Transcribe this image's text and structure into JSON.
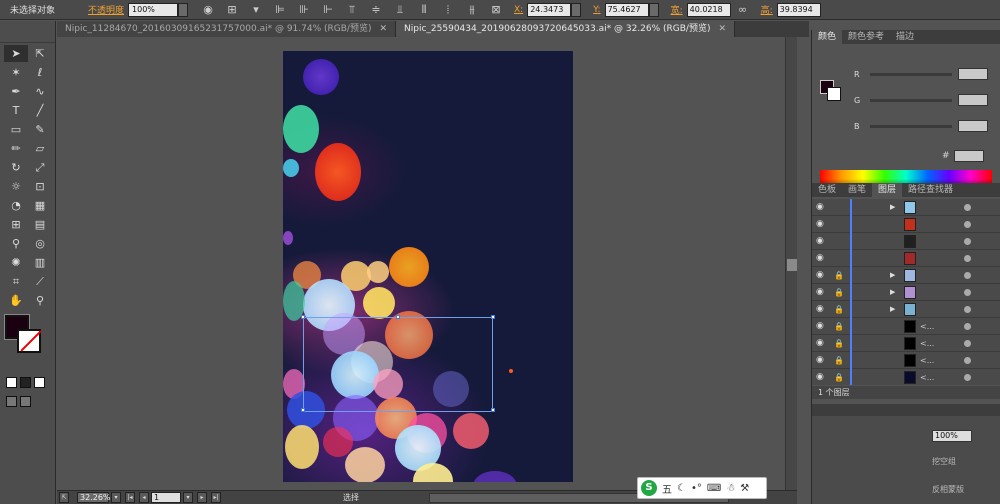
{
  "control_bar": {
    "selection_status": "未选择对象",
    "opacity_label": "不透明度",
    "opacity_value": "100%",
    "x_label": "X:",
    "x_value": "24.3473",
    "y_label": "Y:",
    "y_value": "75.4627",
    "w_label": "宽:",
    "w_value": "40.0218",
    "h_label": "高:",
    "h_value": "39.8394"
  },
  "tabs": [
    {
      "label": "Nipic_11284670_20160309165231757000.ai* @ 91.74% (RGB/预览)",
      "active": false
    },
    {
      "label": "Nipic_25590434_20190628093720645033.ai* @ 32.26% (RGB/预览)",
      "active": true
    }
  ],
  "status_bar": {
    "zoom": "32.26%",
    "page": "1",
    "mode": "选择"
  },
  "color_panel": {
    "tabs": [
      "颜色",
      "颜色参考",
      "描边"
    ],
    "r_label": "R",
    "g_label": "G",
    "b_label": "B",
    "hex_label": "#"
  },
  "layers_panel": {
    "tabs": [
      "色板",
      "画笔",
      "图层",
      "路径查找器"
    ],
    "rows": [
      {
        "locked": false,
        "expandable": true,
        "thumb": "#8fc8e8",
        "name": ""
      },
      {
        "locked": false,
        "expandable": false,
        "thumb": "#c0301a",
        "name": ""
      },
      {
        "locked": false,
        "expandable": false,
        "thumb": "#202020",
        "name": ""
      },
      {
        "locked": false,
        "expandable": false,
        "thumb": "#a02a2a",
        "name": ""
      },
      {
        "locked": true,
        "expandable": true,
        "thumb": "#9fb8e0",
        "name": ""
      },
      {
        "locked": true,
        "expandable": true,
        "thumb": "#b090d0",
        "name": ""
      },
      {
        "locked": true,
        "expandable": true,
        "thumb": "#7ab0d0",
        "name": ""
      },
      {
        "locked": true,
        "expandable": false,
        "thumb": "#000000",
        "name": "<..."
      },
      {
        "locked": true,
        "expandable": false,
        "thumb": "#000000",
        "name": "<..."
      },
      {
        "locked": true,
        "expandable": false,
        "thumb": "#000000",
        "name": "<..."
      },
      {
        "locked": true,
        "expandable": false,
        "thumb": "#0a0a2a",
        "name": "<..."
      }
    ],
    "footer_count": "1 个图层"
  },
  "lower_panel": {
    "percent": "100%",
    "option_1": "挖空组",
    "option_2": "反相蒙版"
  },
  "ime": {
    "logo": "S",
    "mode": "五"
  },
  "colors": {
    "accent_orange": "#f0a030",
    "artboard_bg": "#151a3a",
    "layer_color": "#4f7fff"
  }
}
